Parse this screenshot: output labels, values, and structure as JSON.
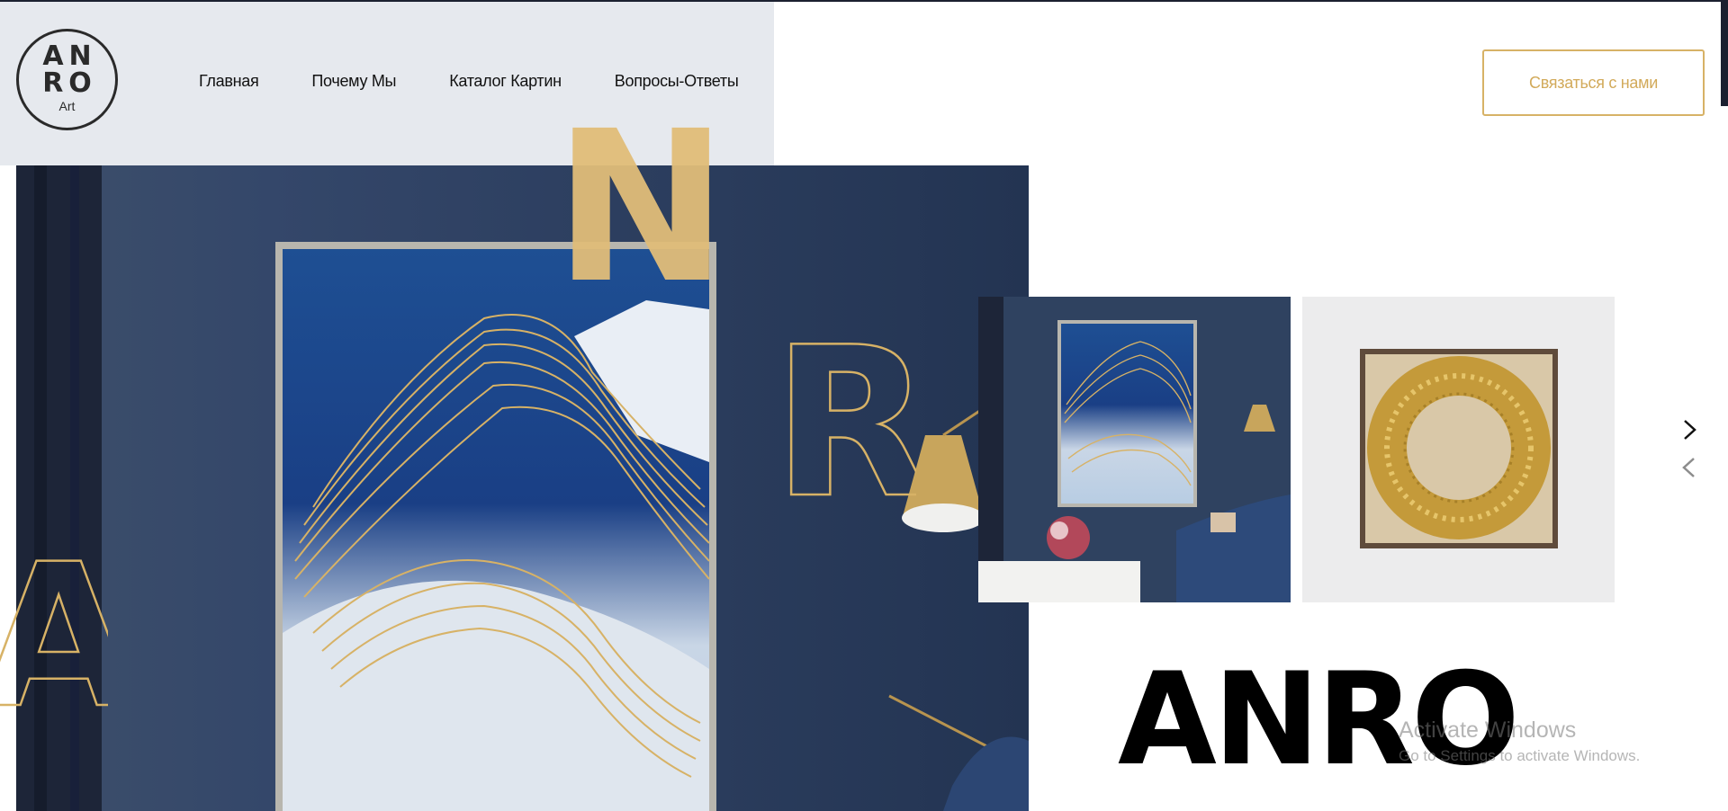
{
  "logo": {
    "line1": "AN",
    "line2": "RO",
    "line3": "Art"
  },
  "nav": {
    "items": [
      "Главная",
      "Почему Мы",
      "Каталог Картин",
      "Вопросы-Ответы"
    ]
  },
  "header": {
    "contact_button": "Связаться с нами"
  },
  "hero": {
    "decor_letters": [
      "N",
      "R",
      "A"
    ],
    "title": "ANRO"
  },
  "slider": {
    "next_icon": "chevron-right-icon",
    "prev_icon": "chevron-left-icon"
  },
  "watermark": {
    "title": "Activate Windows",
    "subtitle": "Go to Settings to activate Windows."
  },
  "colors": {
    "accent_gold": "#d7b266",
    "header_bg": "#e6e9ee",
    "navy": "#2f4260"
  }
}
